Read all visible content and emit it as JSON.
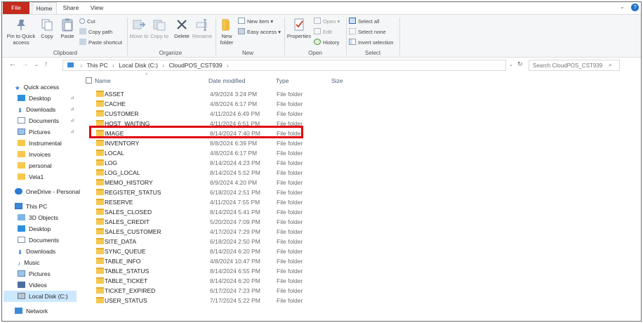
{
  "tabs": [
    "File",
    "Home",
    "Share",
    "View"
  ],
  "ribbon": {
    "clipboard": {
      "label": "Clipboard",
      "pin_to_quick_access": "Pin to Quick access",
      "copy": "Copy",
      "paste": "Paste",
      "cut": "Cut",
      "copy_path": "Copy path",
      "paste_shortcut": "Paste shortcut"
    },
    "organize": {
      "label": "Organize",
      "move_to": "Move to",
      "copy_to": "Copy to",
      "delete": "Delete",
      "rename": "Rename"
    },
    "new": {
      "label": "New",
      "new_folder": "New folder",
      "new_item": "New item",
      "easy_access": "Easy access"
    },
    "open": {
      "label": "Open",
      "properties": "Properties",
      "open": "Open",
      "edit": "Edit",
      "history": "History"
    },
    "select": {
      "label": "Select",
      "select_all": "Select all",
      "select_none": "Select none",
      "invert_selection": "Invert selection"
    }
  },
  "address": {
    "crumbs": [
      "This PC",
      "Local Disk (C:)",
      "CloudPOS_CST939"
    ],
    "search_placeholder": "Search CloudPOS_CST939"
  },
  "nav": {
    "quick_access": "Quick access",
    "quick_items": [
      "Desktop",
      "Downloads",
      "Documents",
      "Pictures",
      "Instrumental",
      "Invoices",
      "personal",
      "Vela1"
    ],
    "onedrive": "OneDrive - Personal",
    "this_pc": "This PC",
    "pc_items": [
      "3D Objects",
      "Desktop",
      "Documents",
      "Downloads",
      "Music",
      "Pictures",
      "Videos",
      "Local Disk (C:)"
    ],
    "network": "Network"
  },
  "columns": {
    "name": "Name",
    "date": "Date modified",
    "type": "Type",
    "size": "Size"
  },
  "files": [
    {
      "name": "ASSET",
      "date": "4/9/2024 3:24 PM",
      "type": "File folder"
    },
    {
      "name": "CACHE",
      "date": "4/8/2024 6:17 PM",
      "type": "File folder"
    },
    {
      "name": "CUSTOMER",
      "date": "4/11/2024 6:49 PM",
      "type": "File folder"
    },
    {
      "name": "HOST_WAITING",
      "date": "4/11/2024 6:51 PM",
      "type": "File folder"
    },
    {
      "name": "IMAGE",
      "date": "8/14/2024 7:40 PM",
      "type": "File folder"
    },
    {
      "name": "INVENTORY",
      "date": "8/8/2024 6:39 PM",
      "type": "File folder"
    },
    {
      "name": "LOCAL",
      "date": "4/8/2024 6:17 PM",
      "type": "File folder"
    },
    {
      "name": "LOG",
      "date": "8/14/2024 4:23 PM",
      "type": "File folder"
    },
    {
      "name": "LOG_LOCAL",
      "date": "8/14/2024 5:52 PM",
      "type": "File folder"
    },
    {
      "name": "MEMO_HISTORY",
      "date": "8/9/2024 4:20 PM",
      "type": "File folder"
    },
    {
      "name": "REGISTER_STATUS",
      "date": "6/18/2024 2:51 PM",
      "type": "File folder"
    },
    {
      "name": "RESERVE",
      "date": "4/11/2024 7:55 PM",
      "type": "File folder"
    },
    {
      "name": "SALES_CLOSED",
      "date": "8/14/2024 5:41 PM",
      "type": "File folder"
    },
    {
      "name": "SALES_CREDIT",
      "date": "5/20/2024 7:09 PM",
      "type": "File folder"
    },
    {
      "name": "SALES_CUSTOMER",
      "date": "4/17/2024 7:29 PM",
      "type": "File folder"
    },
    {
      "name": "SITE_DATA",
      "date": "6/18/2024 2:50 PM",
      "type": "File folder"
    },
    {
      "name": "SYNC_QUEUE",
      "date": "8/14/2024 6:20 PM",
      "type": "File folder"
    },
    {
      "name": "TABLE_INFO",
      "date": "4/8/2024 10:47 PM",
      "type": "File folder"
    },
    {
      "name": "TABLE_STATUS",
      "date": "8/14/2024 6:55 PM",
      "type": "File folder"
    },
    {
      "name": "TABLE_TICKET",
      "date": "8/14/2024 6:20 PM",
      "type": "File folder"
    },
    {
      "name": "TICKET_EXPIRED",
      "date": "6/17/2024 7:23 PM",
      "type": "File folder"
    },
    {
      "name": "USER_STATUS",
      "date": "7/17/2024 5:22 PM",
      "type": "File folder"
    }
  ],
  "colors": {
    "file_tab": "#c42b1c",
    "highlight": "#e0000b",
    "folder": "#f6c84f",
    "selected": "#cce8ff"
  }
}
